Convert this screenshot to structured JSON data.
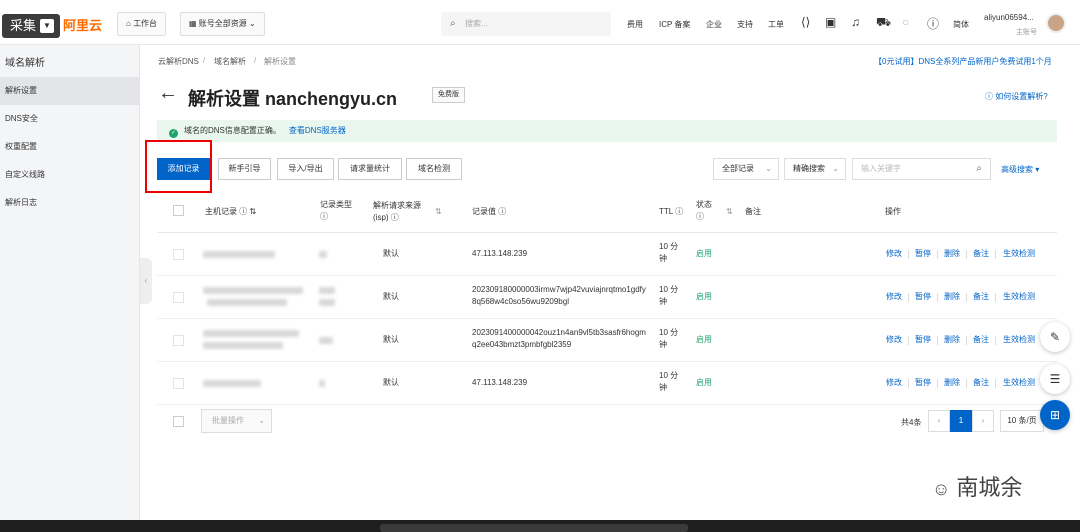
{
  "topbar": {
    "capture_label": "采集",
    "logo": "阿里云",
    "workbench": "工作台",
    "resources": "账号全部资源",
    "search_placeholder": "搜索...",
    "links": [
      "费用",
      "ICP 备案",
      "企业",
      "支持",
      "工单"
    ],
    "lang": "简体",
    "user_name": "aliyun06594...",
    "user_role": "主账号"
  },
  "sidebar": {
    "title": "域名解析",
    "items": [
      "解析设置",
      "DNS安全",
      "权重配置",
      "自定义线路",
      "解析日志"
    ]
  },
  "breadcrumb": [
    "云解析DNS",
    "域名解析",
    "解析设置"
  ],
  "promo": "【0元试用】DNS全系列产品新用户免费试用1个月",
  "page": {
    "back": "←",
    "title": "解析设置 nanchengyu.cn",
    "badge": "免费版",
    "help": "如何设置解析?"
  },
  "notice": {
    "text": "域名的DNS信息配置正确。",
    "link": "查看DNS服务器"
  },
  "toolbar": {
    "add": "添加记录",
    "guide": "新手引导",
    "import_export": "导入/导出",
    "stats": "请求量统计",
    "check": "域名检测",
    "all_records": "全部记录",
    "precise_search": "精确搜索",
    "keyword_placeholder": "输入关键字",
    "advanced": "高级搜索"
  },
  "table": {
    "headers": {
      "host": "主机记录",
      "type": "记录类型",
      "source": "解析请求来源(isp)",
      "value": "记录值",
      "ttl": "TTL",
      "status": "状态",
      "remark": "备注",
      "ops": "操作"
    },
    "rows": [
      {
        "source": "默认",
        "value": "47.113.148.239",
        "ttl": "10 分钟",
        "status": "启用"
      },
      {
        "source": "默认",
        "value": "202309180000003irmw7wjp42vuviajnrqtmo1gdfy8q568w4c0so56wu9209bgl",
        "ttl": "10 分钟",
        "status": "启用"
      },
      {
        "source": "默认",
        "value": "2023091400000042ouz1n4an9vl5tb3sasfr6hogmq2ee043bmzt3pmbfgbl2359",
        "ttl": "10 分钟",
        "status": "启用"
      },
      {
        "source": "默认",
        "value": "47.113.148.239",
        "ttl": "10 分钟",
        "status": "启用"
      }
    ],
    "actions": [
      "修改",
      "暂停",
      "删除",
      "备注",
      "生效检测"
    ]
  },
  "footer": {
    "batch": "批量操作",
    "total": "共4条",
    "page": "1",
    "page_size": "10 条/页"
  },
  "watermark": "南城余"
}
